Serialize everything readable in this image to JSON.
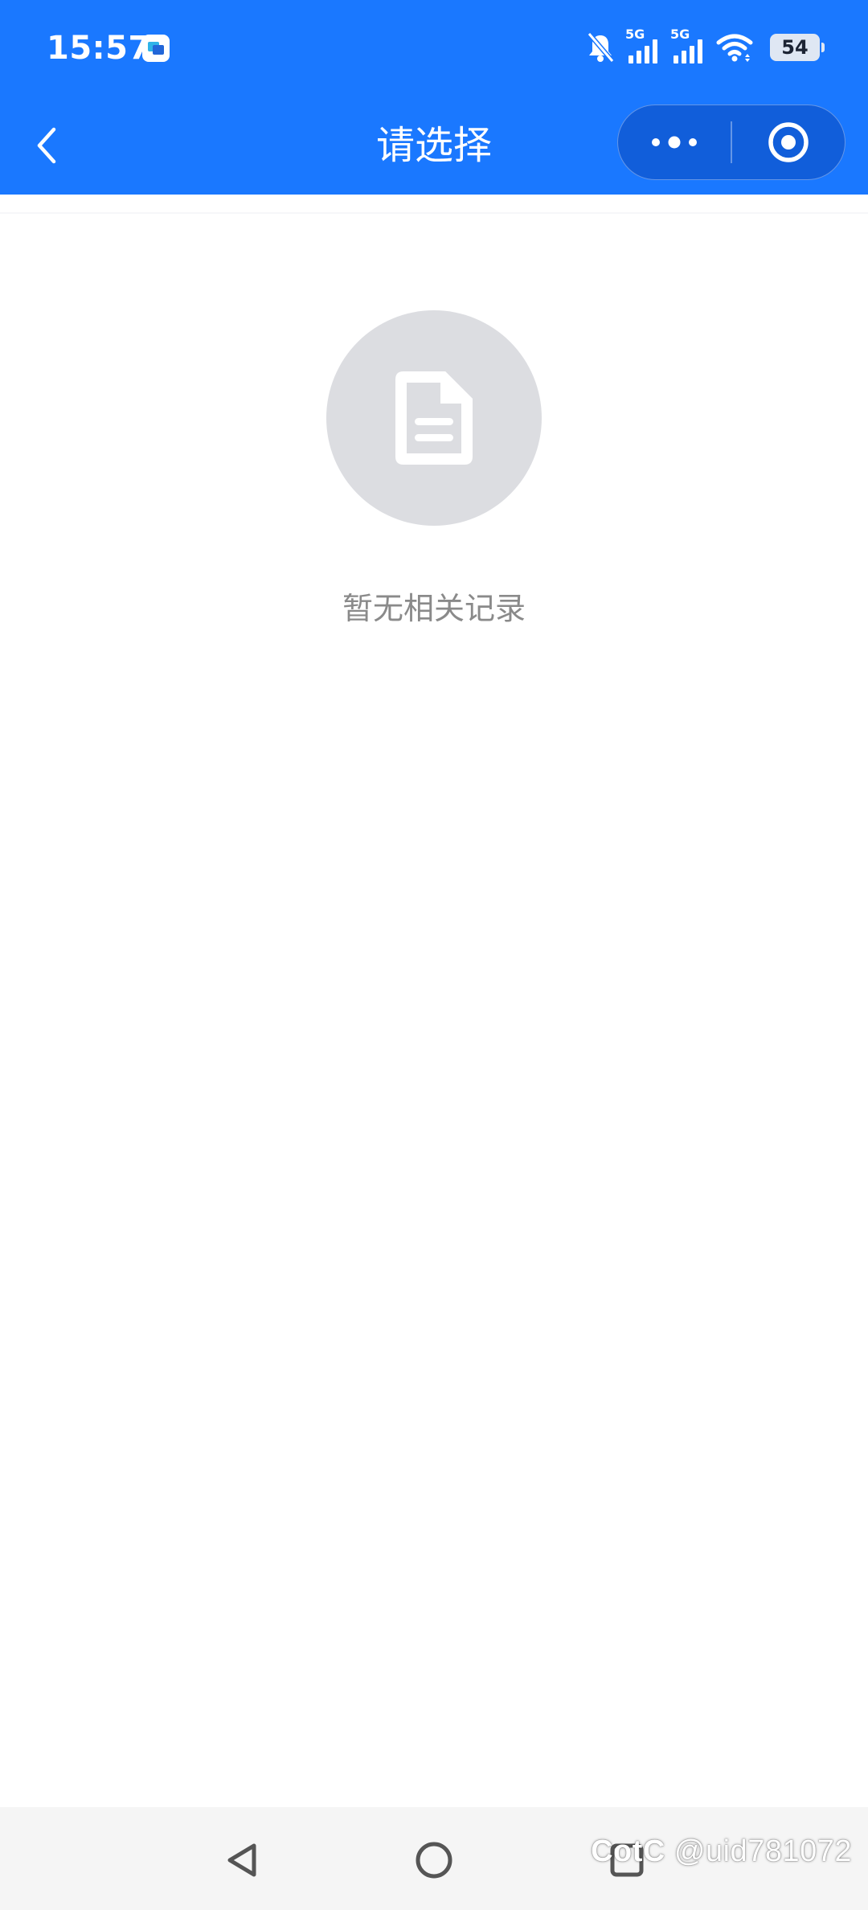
{
  "status_bar": {
    "time": "15:57",
    "network_label_1": "5G",
    "network_label_2": "5G",
    "battery_level": "54",
    "icons": [
      "app-notification-icon",
      "bell-muted-icon",
      "signal-5g-icon",
      "signal-5g-icon",
      "wifi-icon",
      "battery-icon"
    ]
  },
  "nav_bar": {
    "title": "请选择",
    "back_icon": "chevron-left-icon",
    "more_icon": "more-dots-icon",
    "close_icon": "target-circle-icon"
  },
  "empty_state": {
    "icon": "document-icon",
    "message": "暂无相关记录"
  },
  "system_nav": {
    "back_icon": "triangle-back-icon",
    "home_icon": "circle-home-icon",
    "recent_icon": "square-recent-icon"
  },
  "watermark": {
    "text": "@uid781072",
    "logo_text": "CotC"
  },
  "colors": {
    "primary_blue": "#1a78ff",
    "empty_circle": "#dcdde1",
    "empty_text": "#8a8a8a",
    "system_nav_bg": "#f5f5f5"
  }
}
